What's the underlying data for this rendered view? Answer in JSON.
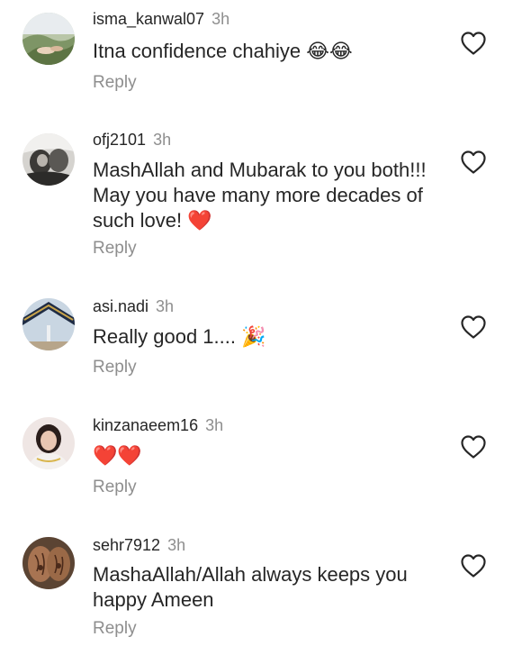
{
  "comments": [
    {
      "username": "isma_kanwal07",
      "time": "3h",
      "text": "Itna confidence chahiye 😂😂",
      "reply_label": "Reply",
      "avatar_icon": "photo-avatar"
    },
    {
      "username": "ofj2101",
      "time": "3h",
      "text": "MashAllah and Mubarak to you both!!! May you have many more decades of such love! ❤️",
      "reply_label": "Reply",
      "avatar_icon": "photo-avatar"
    },
    {
      "username": "asi.nadi",
      "time": "3h",
      "text": "Really good 1.... 🎉",
      "reply_label": "Reply",
      "avatar_icon": "photo-avatar"
    },
    {
      "username": "kinzanaeem16",
      "time": "3h",
      "text": "❤️❤️",
      "reply_label": "Reply",
      "avatar_icon": "photo-avatar"
    },
    {
      "username": "sehr7912",
      "time": "3h",
      "text": "MashaAllah/Allah always keeps you happy Ameen",
      "reply_label": "Reply",
      "avatar_icon": "photo-avatar"
    }
  ],
  "icons": {
    "like": "heart-outline-icon"
  },
  "colors": {
    "text": "#262626",
    "muted": "#8e8e8e",
    "heart": "#e0293a"
  }
}
